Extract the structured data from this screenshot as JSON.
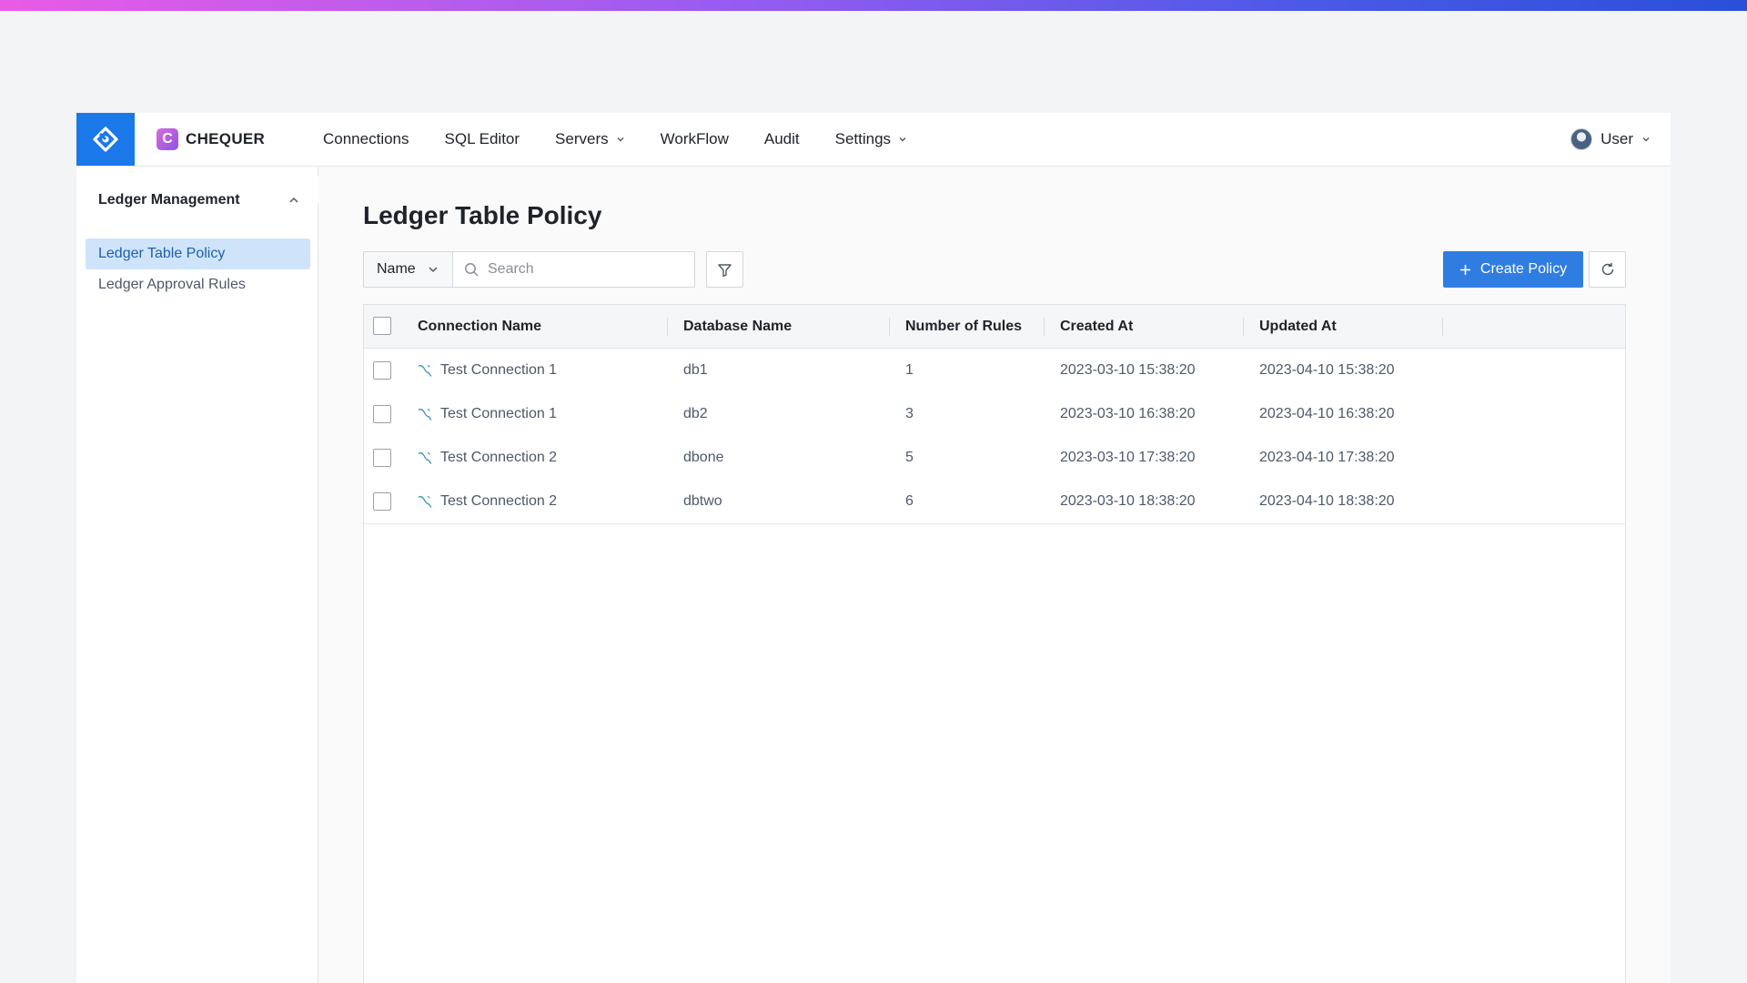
{
  "header": {
    "brand_letter": "C",
    "brand_name": "CHEQUER",
    "nav": [
      {
        "label": "Connections",
        "has_dropdown": false
      },
      {
        "label": "SQL Editor",
        "has_dropdown": false
      },
      {
        "label": "Servers",
        "has_dropdown": true
      },
      {
        "label": "WorkFlow",
        "has_dropdown": false
      },
      {
        "label": "Audit",
        "has_dropdown": false
      },
      {
        "label": "Settings",
        "has_dropdown": true
      }
    ],
    "user_label": "User"
  },
  "sidebar": {
    "group_title": "Ledger Management",
    "items": [
      {
        "label": "Ledger Table Policy",
        "active": true
      },
      {
        "label": "Ledger Approval Rules",
        "active": false
      }
    ]
  },
  "main": {
    "page_title": "Ledger Table Policy",
    "filter_select": "Name",
    "search_placeholder": "Search",
    "create_button": "Create Policy"
  },
  "table": {
    "columns": [
      "Connection Name",
      "Database Name",
      "Number of Rules",
      "Created At",
      "Updated At"
    ],
    "rows": [
      {
        "connection": "Test Connection 1",
        "database": "db1",
        "rules": "1",
        "created": "2023-03-10 15:38:20",
        "updated": "2023-04-10 15:38:20"
      },
      {
        "connection": "Test Connection 1",
        "database": "db2",
        "rules": "3",
        "created": "2023-03-10 16:38:20",
        "updated": "2023-04-10 16:38:20"
      },
      {
        "connection": "Test Connection 2",
        "database": "dbone",
        "rules": "5",
        "created": "2023-03-10 17:38:20",
        "updated": "2023-04-10 17:38:20"
      },
      {
        "connection": "Test Connection 2",
        "database": "dbtwo",
        "rules": "6",
        "created": "2023-03-10 18:38:20",
        "updated": "2023-04-10 18:38:20"
      }
    ]
  },
  "colors": {
    "accent": "#2f7de1",
    "logo_bg": "#1b78e8",
    "active_item_bg": "#cfe4fb"
  },
  "icons": [
    "logo-icon",
    "chevron-down-icon",
    "chevron-up-icon",
    "chevron-left-icon",
    "search-icon",
    "filter-icon",
    "plus-icon",
    "refresh-icon",
    "mysql-connection-icon",
    "avatar"
  ]
}
